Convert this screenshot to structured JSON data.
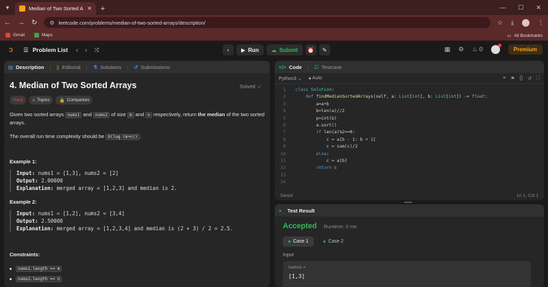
{
  "browser": {
    "tab_title": "Median of Two Sorted Arrays -",
    "url": "leetcode.com/problems/median-of-two-sorted-arrays/description/",
    "bookmarks": [
      "Gmail",
      "Maps"
    ],
    "all_bookmarks": "All Bookmarks"
  },
  "header": {
    "problem_list": "Problem List",
    "run": "Run",
    "submit": "Submit",
    "streak_count": "0",
    "premium": "Premium"
  },
  "description": {
    "tabs": [
      "Description",
      "Editorial",
      "Solutions",
      "Submissions"
    ],
    "title": "4. Median of Two Sorted Arrays",
    "solved": "Solved",
    "difficulty": "Hard",
    "tags": [
      "Topics",
      "Companies"
    ],
    "para1": {
      "t1": "Given two sorted arrays ",
      "c1": "nums1",
      "t2": " and ",
      "c2": "nums2",
      "t3": " of size ",
      "c3": "m",
      "t4": " and ",
      "c4": "n",
      "t5": " respectively, return ",
      "bold": "the median",
      "t6": " of the two sorted arrays."
    },
    "para2": {
      "t1": "The overall run time complexity should be ",
      "c1": "O(log (m+n))",
      "t2": "."
    },
    "examples": [
      {
        "heading": "Example 1:",
        "input_label": "Input:",
        "input": " nums1 = [1,3], nums2 = [2]",
        "output_label": "Output:",
        "output": " 2.00000",
        "expl_label": "Explanation:",
        "expl": " merged array = [1,2,3] and median is 2."
      },
      {
        "heading": "Example 2:",
        "input_label": "Input:",
        "input": " nums1 = [1,2], nums2 = [3,4]",
        "output_label": "Output:",
        "output": " 2.50000",
        "expl_label": "Explanation:",
        "expl": " merged array = [1,2,3,4] and median is (2 + 3) / 2 = 2.5."
      }
    ],
    "constraints_heading": "Constraints:",
    "constraints": [
      "nums1.length == m",
      "nums2.length == n"
    ]
  },
  "code": {
    "tab_code": "Code",
    "tab_testcase": "Testcase",
    "language": "Python3",
    "auto": "Auto",
    "saved": "Saved",
    "cursor": "Ln 1, Col 1",
    "line_numbers": [
      "1",
      "2",
      "3",
      "4",
      "5",
      "6",
      "7",
      "8",
      "9",
      "10",
      "11",
      "12",
      "13",
      "14"
    ]
  },
  "result": {
    "title": "Test Result",
    "status": "Accepted",
    "runtime": "Runtime: 0 ms",
    "cases": [
      "Case 1",
      "Case 2"
    ],
    "input_label": "Input",
    "var_name": "nums1 =",
    "var_value": "[1,3]"
  }
}
